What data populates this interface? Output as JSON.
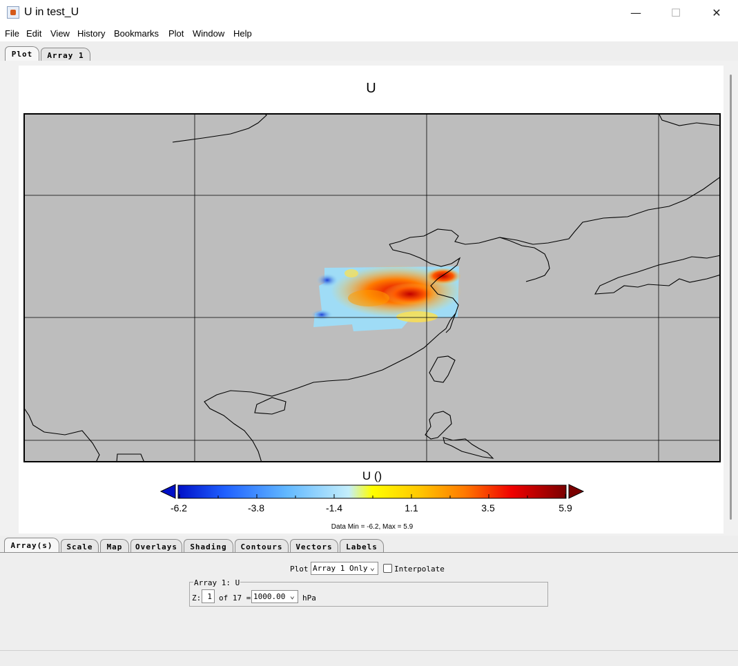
{
  "window": {
    "title": "U in test_U",
    "minimize_glyph": "—",
    "maximize_glyph": "☐",
    "close_glyph": "✕"
  },
  "menu": [
    "File",
    "Edit",
    "View",
    "History",
    "Bookmarks",
    "Plot",
    "Window",
    "Help"
  ],
  "top_tabs": [
    {
      "label": "Plot",
      "active": true
    },
    {
      "label": "Array 1",
      "active": false
    }
  ],
  "plot": {
    "title": "U",
    "colorbar_title": "U ()",
    "colorbar_ticks": [
      "-6.2",
      "-3.8",
      "-1.4",
      "1.1",
      "3.5",
      "5.9"
    ],
    "data_minmax": "Data Min = -6.2, Max = 5.9",
    "colors": {
      "map_background": "#bdbdbd",
      "coastline": "#000000",
      "gridline": "#000000",
      "colorbar_low": "#0010c8",
      "colorbar_mid": "#ffff00",
      "colorbar_high": "#7a0000"
    }
  },
  "bottom_tabs": [
    "Array(s)",
    "Scale",
    "Map",
    "Overlays",
    "Shading",
    "Contours",
    "Vectors",
    "Labels"
  ],
  "controls": {
    "plot_label": "Plot",
    "plot_select": "Array 1 Only",
    "interpolate_label": "Interpolate",
    "interpolate_checked": false,
    "group_title": "Array 1: U",
    "z_label": "Z:",
    "z_value": "1",
    "of_label": "of 17 =",
    "level_select": "1000.00",
    "unit": "hPa"
  }
}
